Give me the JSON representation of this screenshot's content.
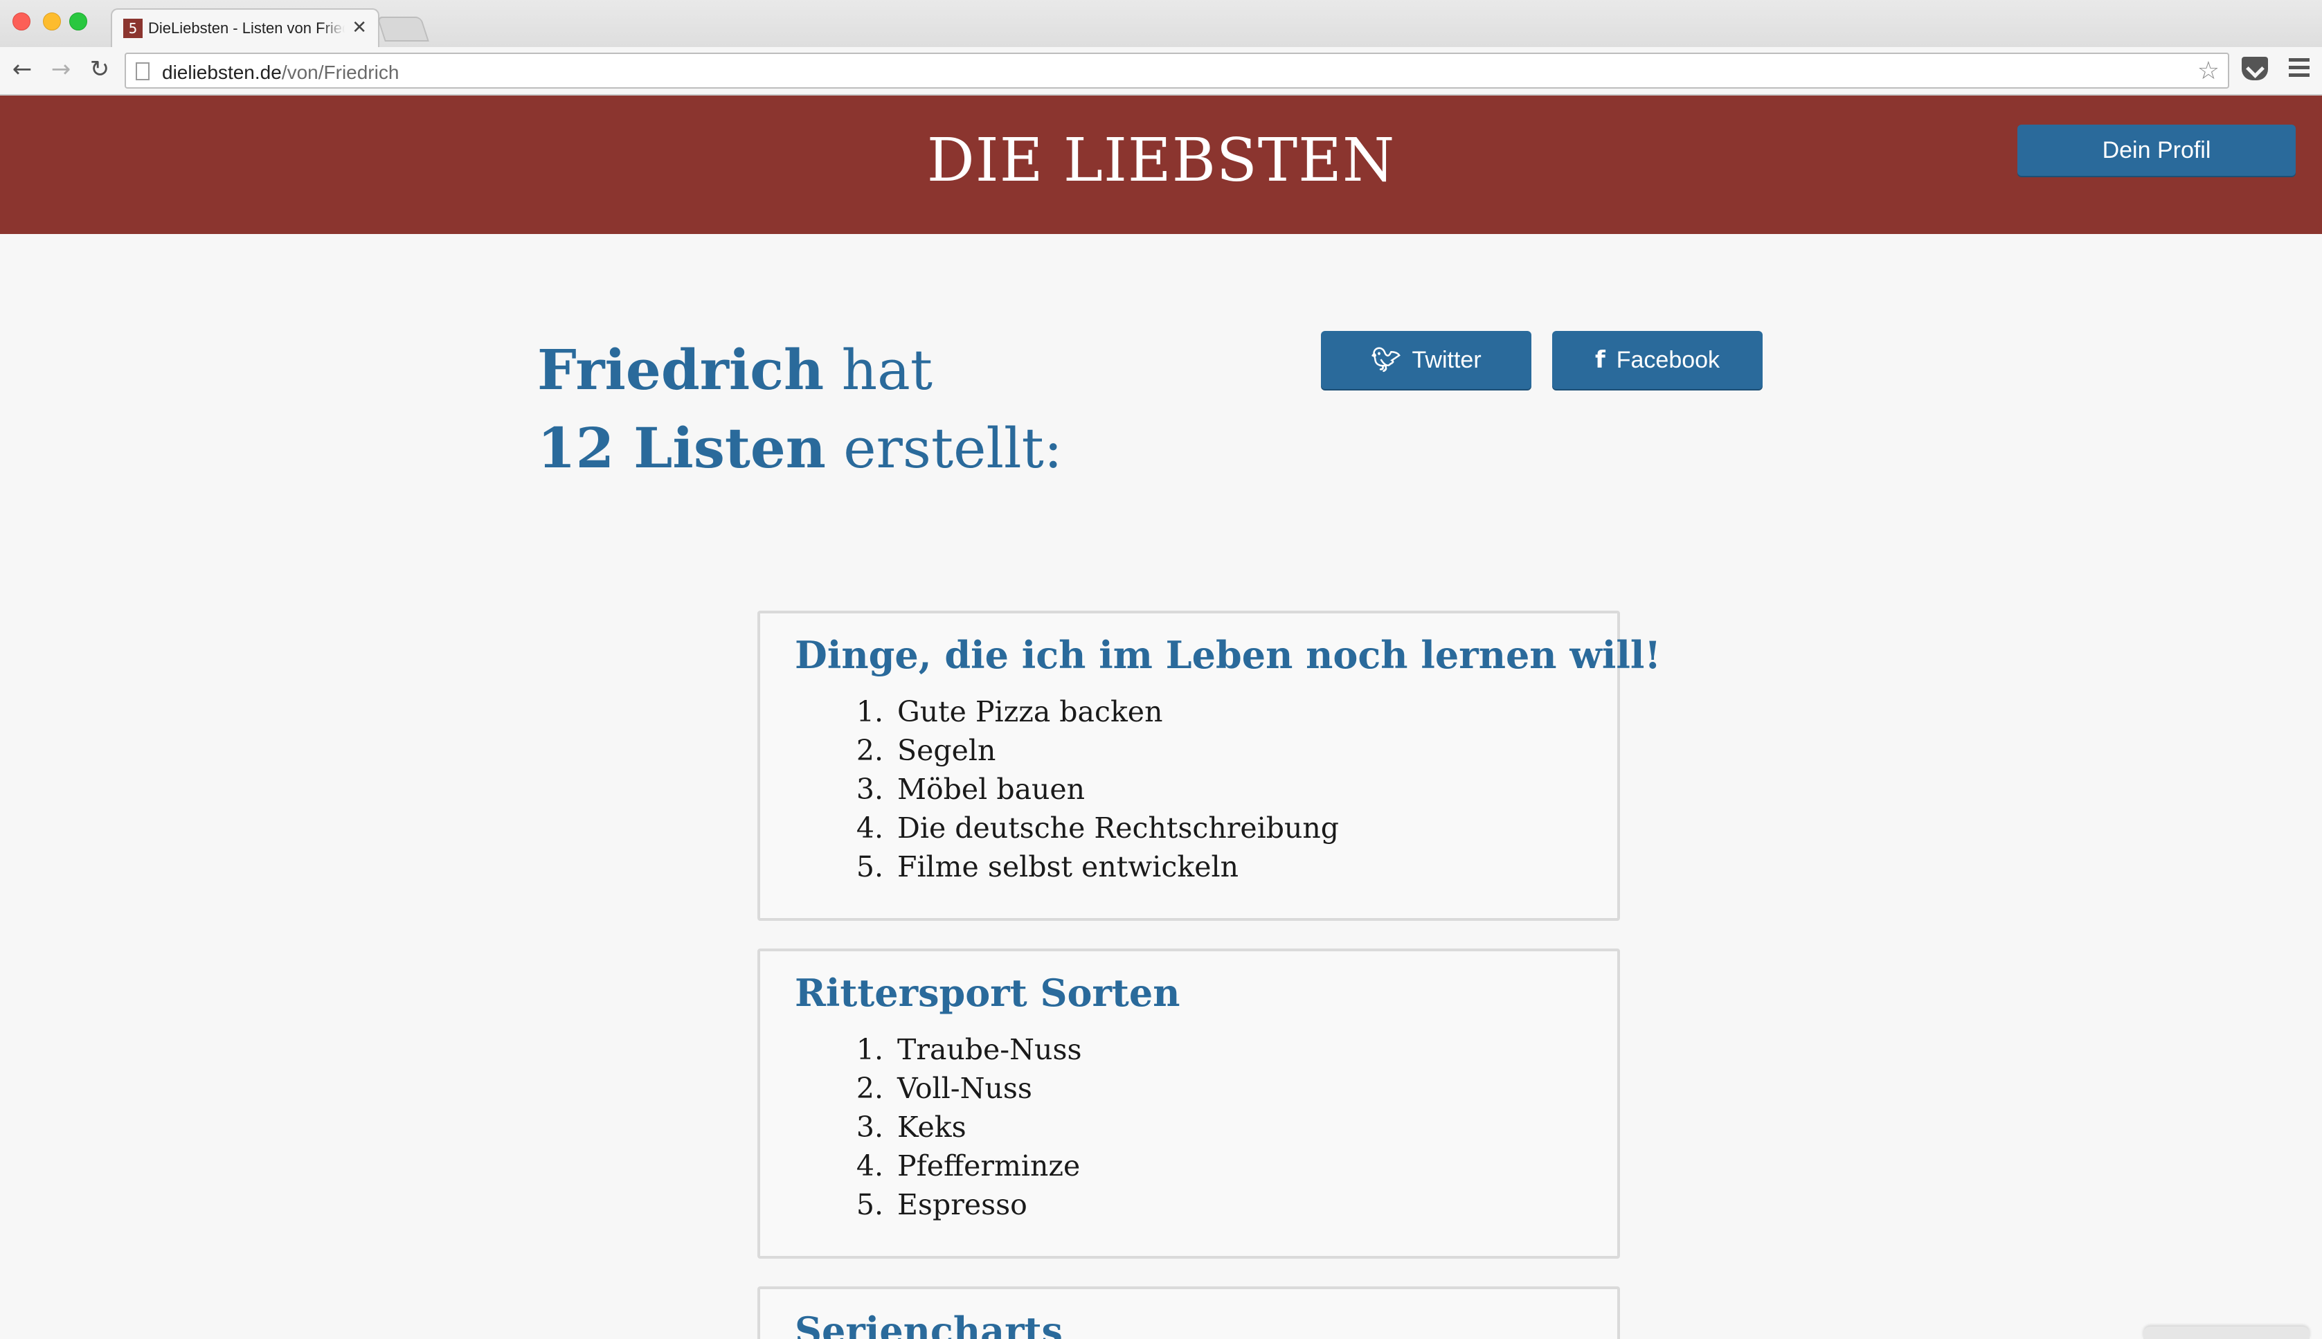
{
  "browser": {
    "tab_title": "DieLiebsten - Listen von Friedrich",
    "tab_favicon": "5",
    "tab_close": "✕",
    "url_host": "dieliebsten.de",
    "url_path": "/von/Friedrich"
  },
  "header": {
    "brand": "DIE LIEBSTEN",
    "profile_button": "Dein Profil"
  },
  "intro": {
    "name": "Friedrich",
    "hat": " hat",
    "count": "12 Listen",
    "suffix": " erstellt:"
  },
  "share": {
    "twitter": "Twitter",
    "facebook": "Facebook"
  },
  "lists": [
    {
      "title": "Dinge, die ich im Leben noch lernen will!",
      "items": [
        {
          "num": "1.",
          "text": "Gute Pizza backen"
        },
        {
          "num": "2.",
          "text": "Segeln"
        },
        {
          "num": "3.",
          "text": "Möbel bauen"
        },
        {
          "num": "4.",
          "text": "Die deutsche Rechtschreibung"
        },
        {
          "num": "5.",
          "text": "Filme selbst entwickeln"
        }
      ]
    },
    {
      "title": "Rittersport Sorten",
      "items": [
        {
          "num": "1.",
          "text": "Traube-Nuss"
        },
        {
          "num": "2.",
          "text": "Voll-Nuss"
        },
        {
          "num": "3.",
          "text": "Keks"
        },
        {
          "num": "4.",
          "text": "Pfefferminze"
        },
        {
          "num": "5.",
          "text": "Espresso"
        }
      ]
    },
    {
      "title": "Seriencharts",
      "items": []
    }
  ],
  "icons": {
    "twitter": "twitter-bird-icon",
    "facebook": "facebook-f-icon",
    "bookmark": "star-icon",
    "pocket": "pocket-icon",
    "menu": "hamburger-menu-icon"
  },
  "colors": {
    "brand_red": "#8b352f",
    "accent_blue": "#2a6a9b",
    "page_bg": "#f7f7f7"
  }
}
